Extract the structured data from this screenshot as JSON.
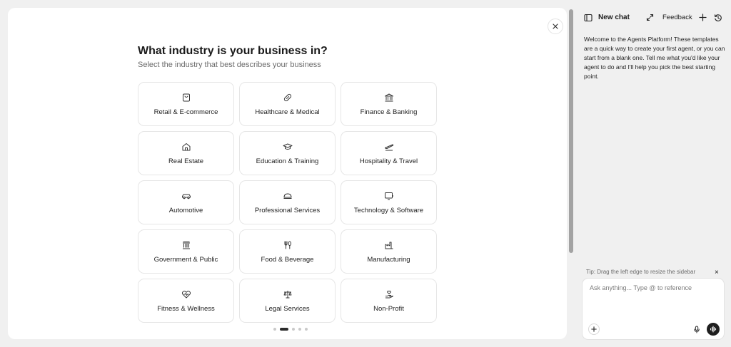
{
  "modal": {
    "title": "What industry is your business in?",
    "subtitle": "Select the industry that best describes your business",
    "close_icon": "close-icon",
    "industries": [
      {
        "label": "Retail & E-commerce",
        "icon": "shopping-bag-icon"
      },
      {
        "label": "Healthcare & Medical",
        "icon": "pill-icon"
      },
      {
        "label": "Finance & Banking",
        "icon": "bank-icon"
      },
      {
        "label": "Real Estate",
        "icon": "house-icon"
      },
      {
        "label": "Education & Training",
        "icon": "graduation-cap-icon"
      },
      {
        "label": "Hospitality & Travel",
        "icon": "plane-icon"
      },
      {
        "label": "Automotive",
        "icon": "car-icon"
      },
      {
        "label": "Professional Services",
        "icon": "briefcase-icon"
      },
      {
        "label": "Technology & Software",
        "icon": "monitor-icon"
      },
      {
        "label": "Government & Public",
        "icon": "landmark-icon"
      },
      {
        "label": "Food & Beverage",
        "icon": "utensils-icon"
      },
      {
        "label": "Manufacturing",
        "icon": "factory-icon"
      },
      {
        "label": "Fitness & Wellness",
        "icon": "heart-pulse-icon"
      },
      {
        "label": "Legal Services",
        "icon": "scale-icon"
      },
      {
        "label": "Non-Profit",
        "icon": "hand-heart-icon"
      }
    ],
    "pagination": {
      "total": 5,
      "active": 2
    }
  },
  "sidebar": {
    "new_chat": "New chat",
    "feedback": "Feedback",
    "welcome": "Welcome to the Agents Platform! These templates are a quick way to create your first agent, or you can start from a blank one. Tell me what you'd like your agent to do and I'll help you pick the best starting point.",
    "tip": "Tip: Drag the left edge to resize the sidebar",
    "tip_close": "×",
    "input_placeholder": "Ask anything... Type @ to reference",
    "input_value": ""
  },
  "colors": {
    "background": "#f0f0f0",
    "surface": "#ffffff",
    "border": "#e6e6e6",
    "text": "#1f1f1f",
    "muted": "#6b6b6b",
    "accent_dark": "#1f1f1f"
  }
}
